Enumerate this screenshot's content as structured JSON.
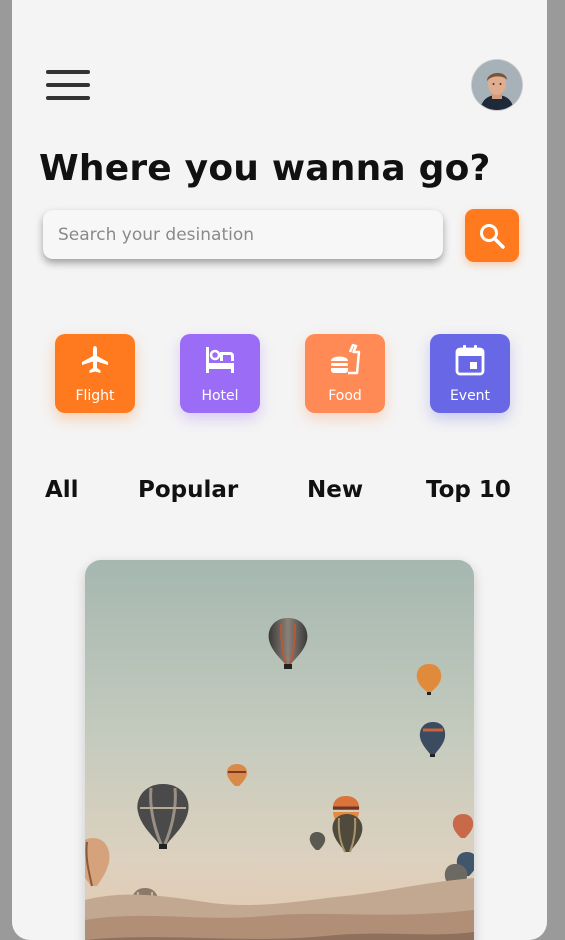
{
  "header": {
    "menu_icon": "hamburger-menu-icon",
    "avatar_icon": "user-avatar"
  },
  "title": "Where you wanna go?",
  "search": {
    "placeholder": "Search your desination",
    "value": "",
    "button_icon": "search-icon"
  },
  "categories": [
    {
      "label": "Flight",
      "icon": "airplane-icon",
      "color": "#ff7a1f"
    },
    {
      "label": "Hotel",
      "icon": "hotel-bed-icon",
      "color": "#9b6cf6"
    },
    {
      "label": "Food",
      "icon": "fast-food-icon",
      "color": "#ff8a55"
    },
    {
      "label": "Event",
      "icon": "calendar-event-icon",
      "color": "#6868e6"
    }
  ],
  "filters": [
    "All",
    "Popular",
    "New",
    "Top 10"
  ],
  "featured": {
    "image": "hot-air-balloons-photo"
  }
}
